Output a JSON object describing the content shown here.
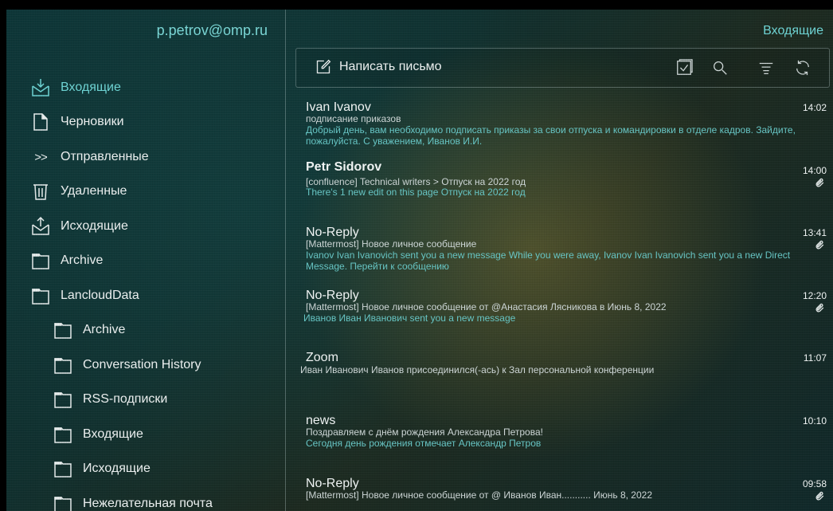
{
  "account": {
    "email": "p.petrov@omp.ru"
  },
  "folders": [
    {
      "label": "Входящие",
      "icon": "inbox-icon",
      "active": true
    },
    {
      "label": "Черновики",
      "icon": "draft-icon"
    },
    {
      "label": "Отправленные",
      "icon": "sent-icon"
    },
    {
      "label": "Удаленные",
      "icon": "trash-icon"
    },
    {
      "label": "Исходящие",
      "icon": "outbox-icon"
    },
    {
      "label": "Archive",
      "icon": "folder-icon"
    },
    {
      "label": "LancloudData",
      "icon": "folder-icon"
    },
    {
      "label": "Archive",
      "icon": "folder-icon",
      "sub": true
    },
    {
      "label": "Conversation History",
      "icon": "folder-icon",
      "sub": true
    },
    {
      "label": "RSS-подписки",
      "icon": "folder-icon",
      "sub": true
    },
    {
      "label": "Входящие",
      "icon": "folder-icon",
      "sub": true
    },
    {
      "label": "Исходящие",
      "icon": "folder-icon",
      "sub": true
    },
    {
      "label": "Нежелательная почта",
      "icon": "folder-icon",
      "sub": true
    }
  ],
  "main": {
    "title": "Входящие",
    "compose_label": "Написать письмо",
    "tools": [
      "select-icon",
      "search-icon",
      "filter-icon",
      "refresh-icon"
    ]
  },
  "messages": [
    {
      "sender": "Ivan Ivanov",
      "time": "14:02",
      "attachment": false,
      "subject": "подписание приказов",
      "preview": "Добрый день, вам необходимо подписать приказы за свои отпуска и командировки в отделе кадров. Зайдите, пожалуйста. С уважением,  Иванов И.И."
    },
    {
      "sender": "Petr Sidorov",
      "time": "14:00",
      "attachment": true,
      "subject": "[confluence] Technical writers > Отпуск на 2022 год",
      "preview": "There's 1 new edit on this page  Отпуск на 2022 год"
    },
    {
      "sender": "No-Reply",
      "time": "13:41",
      "attachment": true,
      "subject": "[Mattermost] Новое личное сообщение",
      "preview": " Ivanov Ivan  Ivanovich sent you a new message While you were away, Ivanov Ivan Ivanovich sent you a new Direct Message. Перейти к сообщению"
    },
    {
      "sender": "No-Reply",
      "time": "12:20",
      "attachment": true,
      "subject": "[Mattermost] Новое личное сообщение от @Анастасия Лясникова в Июнь 8, 2022",
      "preview": "Иванов Иван Иванович sent you a new message"
    },
    {
      "sender": "Zoom",
      "time": "11:07",
      "attachment": false,
      "subject": "",
      "preview": "Иван Иванович Иванов  присоединился(-ась) к Зал персональной конференции"
    },
    {
      "sender": "news",
      "time": "10:10",
      "attachment": false,
      "subject": "Поздравляем с днём рождения Александра Петрова!",
      "preview": " Сегодня день рождения отмечает  Александр Петров"
    },
    {
      "sender": "No-Reply",
      "time": "09:58",
      "attachment": true,
      "subject": "[Mattermost] Новое личное сообщение от @ Иванов Иван........... Июнь 8, 2022",
      "preview": ""
    }
  ]
}
